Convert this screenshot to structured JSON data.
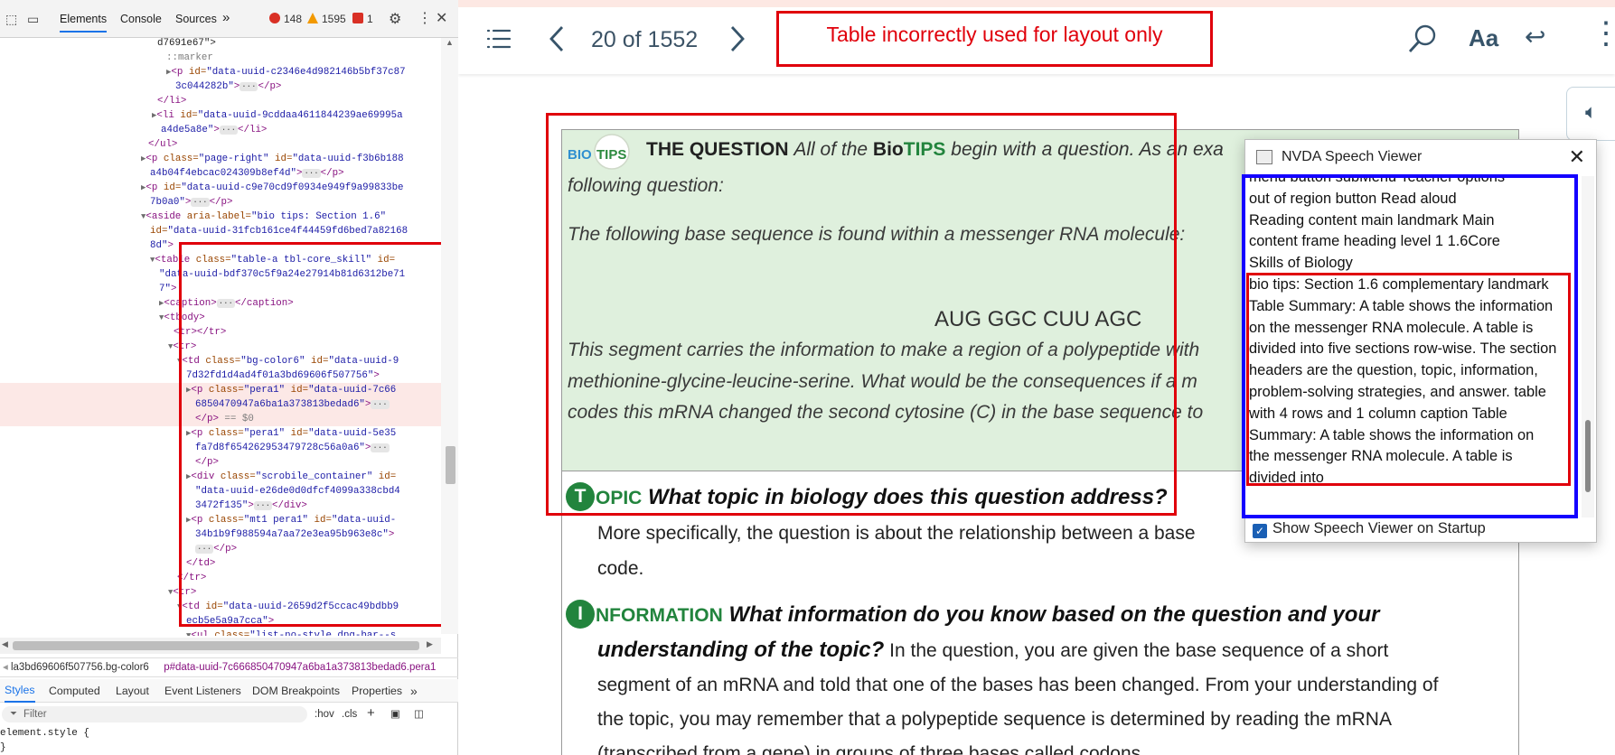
{
  "devtools": {
    "tabs": [
      "Elements",
      "Console",
      "Sources"
    ],
    "more_tabs": "»",
    "counts": {
      "errors": "148",
      "warnings": "1595",
      "issues": "1"
    },
    "tree": [
      {
        "indent": 186,
        "parts": [
          [
            "tx",
            "d7691e67\">"
          ]
        ]
      },
      {
        "indent": 196,
        "parts": [
          [
            "mk",
            "::marker"
          ]
        ]
      },
      {
        "indent": 196,
        "parts": [
          [
            "tw",
            "▶"
          ],
          [
            "tg",
            "<p "
          ],
          [
            "an",
            "id="
          ],
          [
            "av",
            "\"data-uuid-c2346e4d982146b5bf37c87"
          ]
        ]
      },
      {
        "indent": 206,
        "parts": [
          [
            "av",
            "3c044282b\""
          ],
          [
            "tg",
            ">"
          ],
          [
            "dots",
            "···"
          ],
          [
            "tg",
            "</p>"
          ]
        ]
      },
      {
        "indent": 186,
        "parts": [
          [
            "tg",
            "</li>"
          ]
        ]
      },
      {
        "indent": 180,
        "parts": [
          [
            "tw",
            "▶"
          ],
          [
            "tg",
            "<li "
          ],
          [
            "an",
            "id="
          ],
          [
            "av",
            "\"data-uuid-9cddaa4611844239ae69995a"
          ]
        ]
      },
      {
        "indent": 190,
        "parts": [
          [
            "av",
            "a4de5a8e\""
          ],
          [
            "tg",
            ">"
          ],
          [
            "dots",
            "···"
          ],
          [
            "tg",
            "</li>"
          ]
        ]
      },
      {
        "indent": 176,
        "parts": [
          [
            "tg",
            "</ul>"
          ]
        ]
      },
      {
        "indent": 168,
        "parts": [
          [
            "tw",
            "▶"
          ],
          [
            "tg",
            "<p "
          ],
          [
            "an",
            "class="
          ],
          [
            "av",
            "\"page-right\" "
          ],
          [
            "an",
            "id="
          ],
          [
            "av",
            "\"data-uuid-f3b6b188"
          ]
        ]
      },
      {
        "indent": 178,
        "parts": [
          [
            "av",
            "a4b04f4ebcac024309b8ef4d\""
          ],
          [
            "tg",
            ">"
          ],
          [
            "dots",
            "···"
          ],
          [
            "tg",
            "</p>"
          ]
        ]
      },
      {
        "indent": 168,
        "parts": [
          [
            "tw",
            "▶"
          ],
          [
            "tg",
            "<p "
          ],
          [
            "an",
            "id="
          ],
          [
            "av",
            "\"data-uuid-c9e70cd9f0934e949f9a99833be"
          ]
        ]
      },
      {
        "indent": 178,
        "parts": [
          [
            "av",
            "7b0a0\""
          ],
          [
            "tg",
            ">"
          ],
          [
            "dots",
            "···"
          ],
          [
            "tg",
            "</p>"
          ]
        ]
      },
      {
        "indent": 168,
        "parts": [
          [
            "tw",
            "▼"
          ],
          [
            "tg",
            "<aside "
          ],
          [
            "an",
            "aria-label="
          ],
          [
            "av",
            "\"bio tips: Section 1.6\""
          ]
        ]
      },
      {
        "indent": 178,
        "parts": [
          [
            "an",
            "id="
          ],
          [
            "av",
            "\"data-uuid-31fcb161ce4f44459fd6bed7a82168"
          ]
        ]
      },
      {
        "indent": 178,
        "parts": [
          [
            "av",
            "8d\""
          ],
          [
            "tg",
            ">"
          ]
        ]
      },
      {
        "indent": 178,
        "parts": [
          [
            "tw",
            "▼"
          ],
          [
            "tg",
            "<table "
          ],
          [
            "an",
            "class="
          ],
          [
            "av",
            "\"table-a tbl-core_skill\" "
          ],
          [
            "an",
            "id="
          ]
        ]
      },
      {
        "indent": 188,
        "parts": [
          [
            "av",
            "\"data-uuid-bdf370c5f9a24e27914b81d6312be71"
          ]
        ]
      },
      {
        "indent": 188,
        "parts": [
          [
            "av",
            "7\""
          ],
          [
            "tg",
            ">"
          ]
        ]
      },
      {
        "indent": 188,
        "parts": [
          [
            "tw",
            "▶"
          ],
          [
            "tg",
            "<caption>"
          ],
          [
            "dots",
            "···"
          ],
          [
            "tg",
            "</caption>"
          ]
        ]
      },
      {
        "indent": 188,
        "parts": [
          [
            "tw",
            "▼"
          ],
          [
            "tg",
            "<tbody>"
          ]
        ]
      },
      {
        "indent": 204,
        "parts": [
          [
            "tg",
            "<tr></tr>"
          ]
        ]
      },
      {
        "indent": 198,
        "parts": [
          [
            "tw",
            "▼"
          ],
          [
            "tg",
            "<tr>"
          ]
        ]
      },
      {
        "indent": 208,
        "parts": [
          [
            "tw",
            "▼"
          ],
          [
            "tg",
            "<td "
          ],
          [
            "an",
            "class="
          ],
          [
            "av",
            "\"bg-color6\" "
          ],
          [
            "an",
            "id="
          ],
          [
            "av",
            "\"data-uuid-9"
          ]
        ]
      },
      {
        "indent": 218,
        "parts": [
          [
            "av",
            "7d32fd1d4ad4f01a3bd69606f507756\""
          ],
          [
            "tg",
            ">"
          ]
        ]
      },
      {
        "indent": 218,
        "parts": [
          [
            "tw",
            "▶"
          ],
          [
            "tg",
            "<p "
          ],
          [
            "an",
            "class="
          ],
          [
            "av",
            "\"pera1\" "
          ],
          [
            "an",
            "id="
          ],
          [
            "av",
            "\"data-uuid-7c66"
          ]
        ]
      },
      {
        "indent": 228,
        "parts": [
          [
            "av",
            "6850470947a6ba1a373813bedad6\""
          ],
          [
            "tg",
            ">"
          ],
          [
            "dots",
            "···"
          ]
        ]
      },
      {
        "indent": 228,
        "parts": [
          [
            "tg",
            "</p>"
          ],
          [
            "mk",
            " == $0"
          ]
        ]
      },
      {
        "indent": 218,
        "parts": [
          [
            "tw",
            "▶"
          ],
          [
            "tg",
            "<p "
          ],
          [
            "an",
            "class="
          ],
          [
            "av",
            "\"pera1\" "
          ],
          [
            "an",
            "id="
          ],
          [
            "av",
            "\"data-uuid-5e35"
          ]
        ]
      },
      {
        "indent": 228,
        "parts": [
          [
            "av",
            "fa7d8f654262953479728c56a0a6\""
          ],
          [
            "tg",
            ">"
          ],
          [
            "dots",
            "···"
          ]
        ]
      },
      {
        "indent": 228,
        "parts": [
          [
            "tg",
            "</p>"
          ]
        ]
      },
      {
        "indent": 218,
        "parts": [
          [
            "tw",
            "▶"
          ],
          [
            "tg",
            "<div "
          ],
          [
            "an",
            "class="
          ],
          [
            "av",
            "\"scrobile_container\" "
          ],
          [
            "an",
            "id="
          ]
        ]
      },
      {
        "indent": 228,
        "parts": [
          [
            "av",
            "\"data-uuid-e26de0d0dfcf4099a338cbd4"
          ]
        ]
      },
      {
        "indent": 228,
        "parts": [
          [
            "av",
            "3472f135\""
          ],
          [
            "tg",
            ">"
          ],
          [
            "dots",
            "···"
          ],
          [
            "tg",
            "</div>"
          ]
        ]
      },
      {
        "indent": 218,
        "parts": [
          [
            "tw",
            "▶"
          ],
          [
            "tg",
            "<p "
          ],
          [
            "an",
            "class="
          ],
          [
            "av",
            "\"mt1 pera1\" "
          ],
          [
            "an",
            "id="
          ],
          [
            "av",
            "\"data-uuid-"
          ]
        ]
      },
      {
        "indent": 228,
        "parts": [
          [
            "av",
            "34b1b9f988594a7aa72e3ea95b963e8c\""
          ],
          [
            "tg",
            ">"
          ]
        ]
      },
      {
        "indent": 228,
        "parts": [
          [
            "dots",
            "···"
          ],
          [
            "tg",
            "</p>"
          ]
        ]
      },
      {
        "indent": 218,
        "parts": [
          [
            "tg",
            "</td>"
          ]
        ]
      },
      {
        "indent": 208,
        "parts": [
          [
            "tg",
            "</tr>"
          ]
        ]
      },
      {
        "indent": 198,
        "parts": [
          [
            "tw",
            "▼"
          ],
          [
            "tg",
            "<tr>"
          ]
        ]
      },
      {
        "indent": 208,
        "parts": [
          [
            "tw",
            "▼"
          ],
          [
            "tg",
            "<td "
          ],
          [
            "an",
            "id="
          ],
          [
            "av",
            "\"data-uuid-2659d2f5ccac49bdbb9"
          ]
        ]
      },
      {
        "indent": 218,
        "parts": [
          [
            "av",
            "ecb5e5a9a7cca\""
          ],
          [
            "tg",
            ">"
          ]
        ]
      },
      {
        "indent": 218,
        "parts": [
          [
            "tw",
            "▼"
          ],
          [
            "tg",
            "<ul "
          ],
          [
            "an",
            "class="
          ],
          [
            "av",
            "\"list-no-stvle dpg-bar--s"
          ]
        ]
      }
    ],
    "breadcrumb": [
      "la3bd69606f507756.bg-color6",
      "p#data-uuid-7c666850470947a6ba1a373813bedad6.pera1"
    ],
    "style_tabs": [
      "Styles",
      "Computed",
      "Layout",
      "Event Listeners",
      "DOM Breakpoints",
      "Properties"
    ],
    "filter_placeholder": "Filter",
    "filter_tools": [
      ":hov",
      ".cls",
      "+"
    ],
    "element_style": "element.style {",
    "element_style_close": "}"
  },
  "reader": {
    "page_indicator": "20 of 1552",
    "layout_note": "Table incorrectly used for layout only",
    "question": {
      "logo_bio": "BIO",
      "logo_tips": "TIPS",
      "heading_bold": "THE QUESTION",
      "heading_rest_1": "All of the ",
      "heading_bio": "Bio",
      "heading_tips": "TIPS",
      "heading_rest_2": " begin with a question. As an exa",
      "line2": "following question:",
      "line3": "The following base sequence is found within a messenger RNA molecule:",
      "sequence": "AUG GGC CUU AGC",
      "line4": "This segment carries the information to make a region of a polypeptide with",
      "line5": "methionine-glycine-leucine-serine. What would be the consequences if a m",
      "line6": "codes this mRNA changed the second cytosine (C) in the base sequence to"
    },
    "topic": {
      "letter": "T",
      "word": "OPIC",
      "question": "What topic in biology does this question address?",
      "body1": "More specifically, the question is about the relationship between a base",
      "body1_tail": "code.",
      "body1_end": ""
    },
    "information": {
      "letter": "I",
      "word": "NFORMATION",
      "question1": "What information do you know based on the question and your",
      "question2": "understanding of the topic?",
      "body2": " In the question, you are given the base sequence of a short",
      "body3": "segment of an mRNA and told that one of the bases has been changed. From your understanding of",
      "body4": "the topic, you may remember that a polypeptide sequence is determined by reading the mRNA",
      "body5": "(transcribed from a gene) in groups of three bases called codons."
    },
    "nvda": {
      "title": "NVDA Speech Viewer",
      "lines": [
        "menu button  subMenu    Teacher options",
        "out of region  button    Read aloud",
        "Reading content  main landmark    Main",
        "content  frame    heading    level 1  1.6Core",
        "Skills of Biology",
        "bio tips: Section 1.6  complementary landmark",
        "Table Summary: A table shows the information",
        "on the messenger RNA molecule. A table is",
        "divided into five sections row-wise. The section",
        "headers are the question, topic, information,",
        "problem-solving strategies, and answer.  table",
        "with 4 rows and 1 column  caption    Table",
        "Summary: A table shows the information on",
        "the messenger RNA molecule. A table is",
        "divided into"
      ],
      "show_on_startup": "Show Speech Viewer on Startup"
    }
  }
}
